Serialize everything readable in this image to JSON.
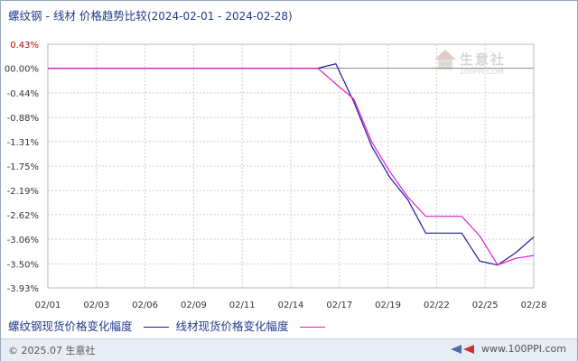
{
  "header": {
    "title": "螺纹钢 - 线材 价格趋势比较",
    "date_range": "(2024-02-01 - 2024-02-28)"
  },
  "watermark": {
    "brand": "生意社",
    "url": "100PPI.COM"
  },
  "footer": {
    "copyright": "© 2025.07 生意社",
    "site": "www.100PPI.com"
  },
  "colors": {
    "series1": "#1a1aa8",
    "series2": "#e020c8",
    "top_tick": "#cc0000",
    "grid": "#d0d0d0",
    "zero_line": "#8c8c8c"
  },
  "chart_data": {
    "type": "line",
    "x_labels": [
      "02/01",
      "02/03",
      "02/06",
      "02/09",
      "02/11",
      "02/14",
      "02/17",
      "02/19",
      "02/22",
      "02/25",
      "02/28"
    ],
    "y_ticks": [
      0.43,
      0.0,
      -0.44,
      -0.88,
      -1.31,
      -1.75,
      -2.19,
      -2.62,
      -3.06,
      -3.5,
      -3.93
    ],
    "y_tick_labels": [
      "0.43%",
      "00.00%",
      "-0.44%",
      "-0.88%",
      "-1.31%",
      "-1.75%",
      "-2.19%",
      "-2.62%",
      "-3.06%",
      "-3.50%",
      "-3.93%"
    ],
    "ylim": [
      -3.93,
      0.43
    ],
    "grid": true,
    "legend_position": "bottom-left",
    "series": [
      {
        "name": "螺纹钢现货价格变化幅度",
        "x": [
          "2024-02-01",
          "2024-02-16",
          "2024-02-17",
          "2024-02-18",
          "2024-02-19",
          "2024-02-20",
          "2024-02-21",
          "2024-02-22",
          "2024-02-23",
          "2024-02-24",
          "2024-02-25",
          "2024-02-26",
          "2024-02-27",
          "2024-02-28"
        ],
        "values": [
          0.0,
          0.0,
          0.08,
          -0.6,
          -1.4,
          -1.95,
          -2.35,
          -2.95,
          -2.95,
          -2.95,
          -3.45,
          -3.52,
          -3.3,
          -3.02
        ]
      },
      {
        "name": "线材现货价格变化幅度",
        "x": [
          "2024-02-01",
          "2024-02-16",
          "2024-02-17",
          "2024-02-18",
          "2024-02-19",
          "2024-02-20",
          "2024-02-21",
          "2024-02-22",
          "2024-02-23",
          "2024-02-24",
          "2024-02-25",
          "2024-02-26",
          "2024-02-27",
          "2024-02-28"
        ],
        "values": [
          0.0,
          0.0,
          -0.28,
          -0.55,
          -1.32,
          -1.85,
          -2.3,
          -2.65,
          -2.65,
          -2.65,
          -3.0,
          -3.52,
          -3.4,
          -3.35
        ]
      }
    ]
  }
}
